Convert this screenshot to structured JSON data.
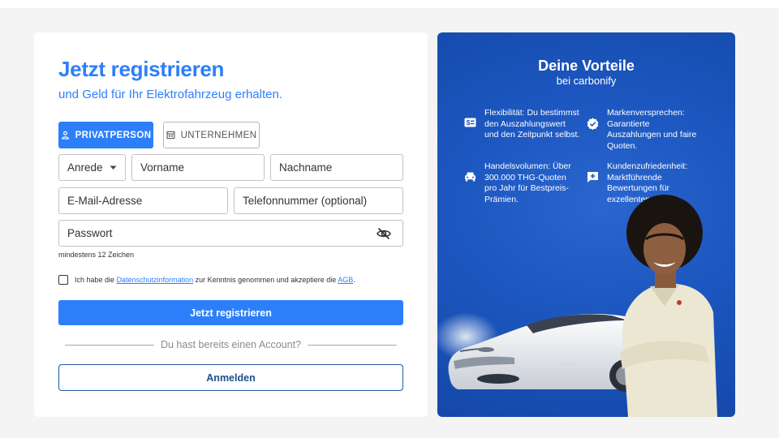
{
  "form": {
    "title": "Jetzt registrieren",
    "subtitle": "und Geld für Ihr Elektrofahrzeug erhalten.",
    "tabs": {
      "private_label": "PRIVATPERSON",
      "company_label": "UNTERNEHMEN",
      "active": "PRIVATPERSON"
    },
    "fields": {
      "salutation": "Anrede",
      "first_name": "Vorname",
      "last_name": "Nachname",
      "email": "E-Mail-Adresse",
      "phone": "Telefonnummer (optional)",
      "password": "Passwort"
    },
    "password_hint": "mindestens 12 Zeichen",
    "consent": {
      "prefix": "Ich habe die",
      "privacy_link": "Datenschutzinformation",
      "middle": "zur Kenntnis genommen und akzeptiere die",
      "terms_link": "AGB",
      "suffix": ".",
      "checked": false
    },
    "register_button": "Jetzt registrieren",
    "divider_text": "Du hast bereits einen Account?",
    "login_button": "Anmelden"
  },
  "panel": {
    "title": "Deine Vorteile",
    "subtitle": "bei carbonify",
    "benefits": [
      {
        "icon": "money-icon",
        "text": "Flexibilität: Du bestimmst den Auszahlungswert und den Zeitpunkt selbst."
      },
      {
        "icon": "verified-badge-icon",
        "text": "Markenversprechen: Garantierte Auszahlungen und faire Quoten."
      },
      {
        "icon": "car-icon",
        "text": "Handelsvolumen: Über 300.000 THG-Quoten pro Jahr für Bestpreis-Prämien."
      },
      {
        "icon": "support-chat-icon",
        "text": "Kundenzufriedenheit: Marktführende Bewertungen für exzellenten Service."
      }
    ]
  },
  "colors": {
    "primary": "#2d7ff9",
    "panel_blue": "#1c56bf",
    "outline_dark": "#1f5a9e",
    "page_background": "#f4f4f4"
  }
}
